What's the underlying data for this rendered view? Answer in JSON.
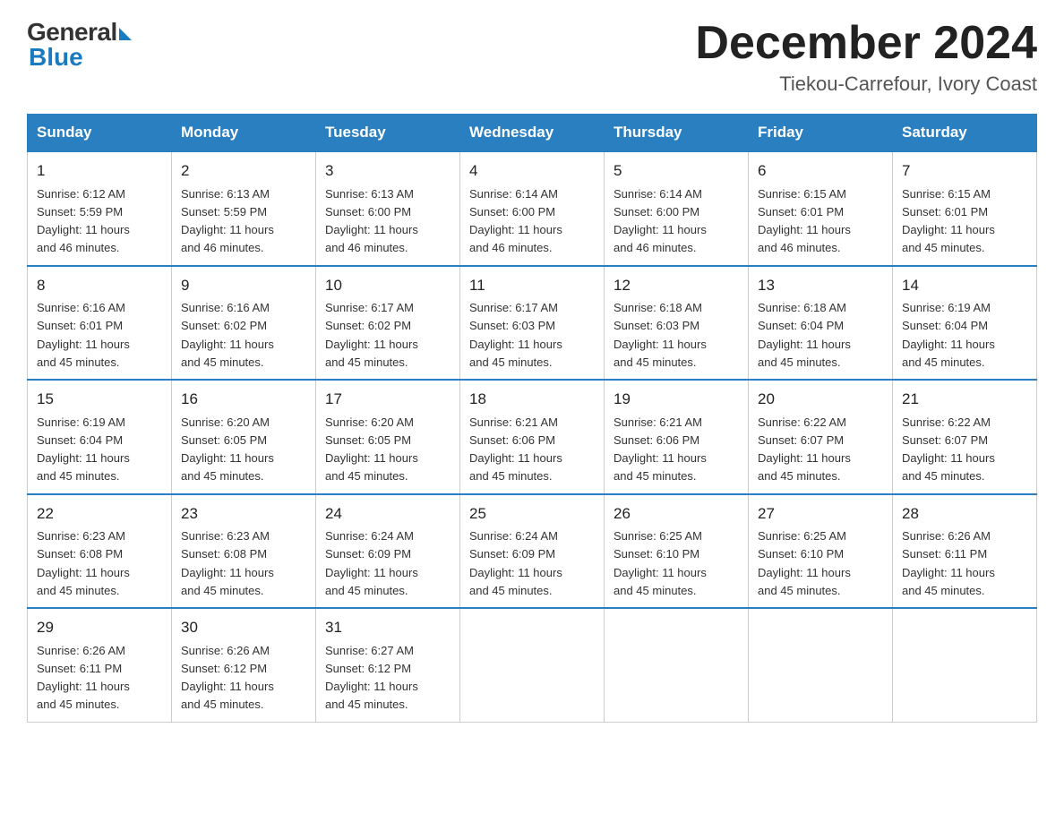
{
  "logo": {
    "general": "General",
    "blue": "Blue"
  },
  "title": {
    "month": "December 2024",
    "location": "Tiekou-Carrefour, Ivory Coast"
  },
  "headers": [
    "Sunday",
    "Monday",
    "Tuesday",
    "Wednesday",
    "Thursday",
    "Friday",
    "Saturday"
  ],
  "weeks": [
    [
      {
        "day": "1",
        "sunrise": "6:12 AM",
        "sunset": "5:59 PM",
        "daylight": "11 hours and 46 minutes."
      },
      {
        "day": "2",
        "sunrise": "6:13 AM",
        "sunset": "5:59 PM",
        "daylight": "11 hours and 46 minutes."
      },
      {
        "day": "3",
        "sunrise": "6:13 AM",
        "sunset": "6:00 PM",
        "daylight": "11 hours and 46 minutes."
      },
      {
        "day": "4",
        "sunrise": "6:14 AM",
        "sunset": "6:00 PM",
        "daylight": "11 hours and 46 minutes."
      },
      {
        "day": "5",
        "sunrise": "6:14 AM",
        "sunset": "6:00 PM",
        "daylight": "11 hours and 46 minutes."
      },
      {
        "day": "6",
        "sunrise": "6:15 AM",
        "sunset": "6:01 PM",
        "daylight": "11 hours and 46 minutes."
      },
      {
        "day": "7",
        "sunrise": "6:15 AM",
        "sunset": "6:01 PM",
        "daylight": "11 hours and 45 minutes."
      }
    ],
    [
      {
        "day": "8",
        "sunrise": "6:16 AM",
        "sunset": "6:01 PM",
        "daylight": "11 hours and 45 minutes."
      },
      {
        "day": "9",
        "sunrise": "6:16 AM",
        "sunset": "6:02 PM",
        "daylight": "11 hours and 45 minutes."
      },
      {
        "day": "10",
        "sunrise": "6:17 AM",
        "sunset": "6:02 PM",
        "daylight": "11 hours and 45 minutes."
      },
      {
        "day": "11",
        "sunrise": "6:17 AM",
        "sunset": "6:03 PM",
        "daylight": "11 hours and 45 minutes."
      },
      {
        "day": "12",
        "sunrise": "6:18 AM",
        "sunset": "6:03 PM",
        "daylight": "11 hours and 45 minutes."
      },
      {
        "day": "13",
        "sunrise": "6:18 AM",
        "sunset": "6:04 PM",
        "daylight": "11 hours and 45 minutes."
      },
      {
        "day": "14",
        "sunrise": "6:19 AM",
        "sunset": "6:04 PM",
        "daylight": "11 hours and 45 minutes."
      }
    ],
    [
      {
        "day": "15",
        "sunrise": "6:19 AM",
        "sunset": "6:04 PM",
        "daylight": "11 hours and 45 minutes."
      },
      {
        "day": "16",
        "sunrise": "6:20 AM",
        "sunset": "6:05 PM",
        "daylight": "11 hours and 45 minutes."
      },
      {
        "day": "17",
        "sunrise": "6:20 AM",
        "sunset": "6:05 PM",
        "daylight": "11 hours and 45 minutes."
      },
      {
        "day": "18",
        "sunrise": "6:21 AM",
        "sunset": "6:06 PM",
        "daylight": "11 hours and 45 minutes."
      },
      {
        "day": "19",
        "sunrise": "6:21 AM",
        "sunset": "6:06 PM",
        "daylight": "11 hours and 45 minutes."
      },
      {
        "day": "20",
        "sunrise": "6:22 AM",
        "sunset": "6:07 PM",
        "daylight": "11 hours and 45 minutes."
      },
      {
        "day": "21",
        "sunrise": "6:22 AM",
        "sunset": "6:07 PM",
        "daylight": "11 hours and 45 minutes."
      }
    ],
    [
      {
        "day": "22",
        "sunrise": "6:23 AM",
        "sunset": "6:08 PM",
        "daylight": "11 hours and 45 minutes."
      },
      {
        "day": "23",
        "sunrise": "6:23 AM",
        "sunset": "6:08 PM",
        "daylight": "11 hours and 45 minutes."
      },
      {
        "day": "24",
        "sunrise": "6:24 AM",
        "sunset": "6:09 PM",
        "daylight": "11 hours and 45 minutes."
      },
      {
        "day": "25",
        "sunrise": "6:24 AM",
        "sunset": "6:09 PM",
        "daylight": "11 hours and 45 minutes."
      },
      {
        "day": "26",
        "sunrise": "6:25 AM",
        "sunset": "6:10 PM",
        "daylight": "11 hours and 45 minutes."
      },
      {
        "day": "27",
        "sunrise": "6:25 AM",
        "sunset": "6:10 PM",
        "daylight": "11 hours and 45 minutes."
      },
      {
        "day": "28",
        "sunrise": "6:26 AM",
        "sunset": "6:11 PM",
        "daylight": "11 hours and 45 minutes."
      }
    ],
    [
      {
        "day": "29",
        "sunrise": "6:26 AM",
        "sunset": "6:11 PM",
        "daylight": "11 hours and 45 minutes."
      },
      {
        "day": "30",
        "sunrise": "6:26 AM",
        "sunset": "6:12 PM",
        "daylight": "11 hours and 45 minutes."
      },
      {
        "day": "31",
        "sunrise": "6:27 AM",
        "sunset": "6:12 PM",
        "daylight": "11 hours and 45 minutes."
      },
      null,
      null,
      null,
      null
    ]
  ],
  "labels": {
    "sunrise": "Sunrise:",
    "sunset": "Sunset:",
    "daylight": "Daylight:"
  }
}
